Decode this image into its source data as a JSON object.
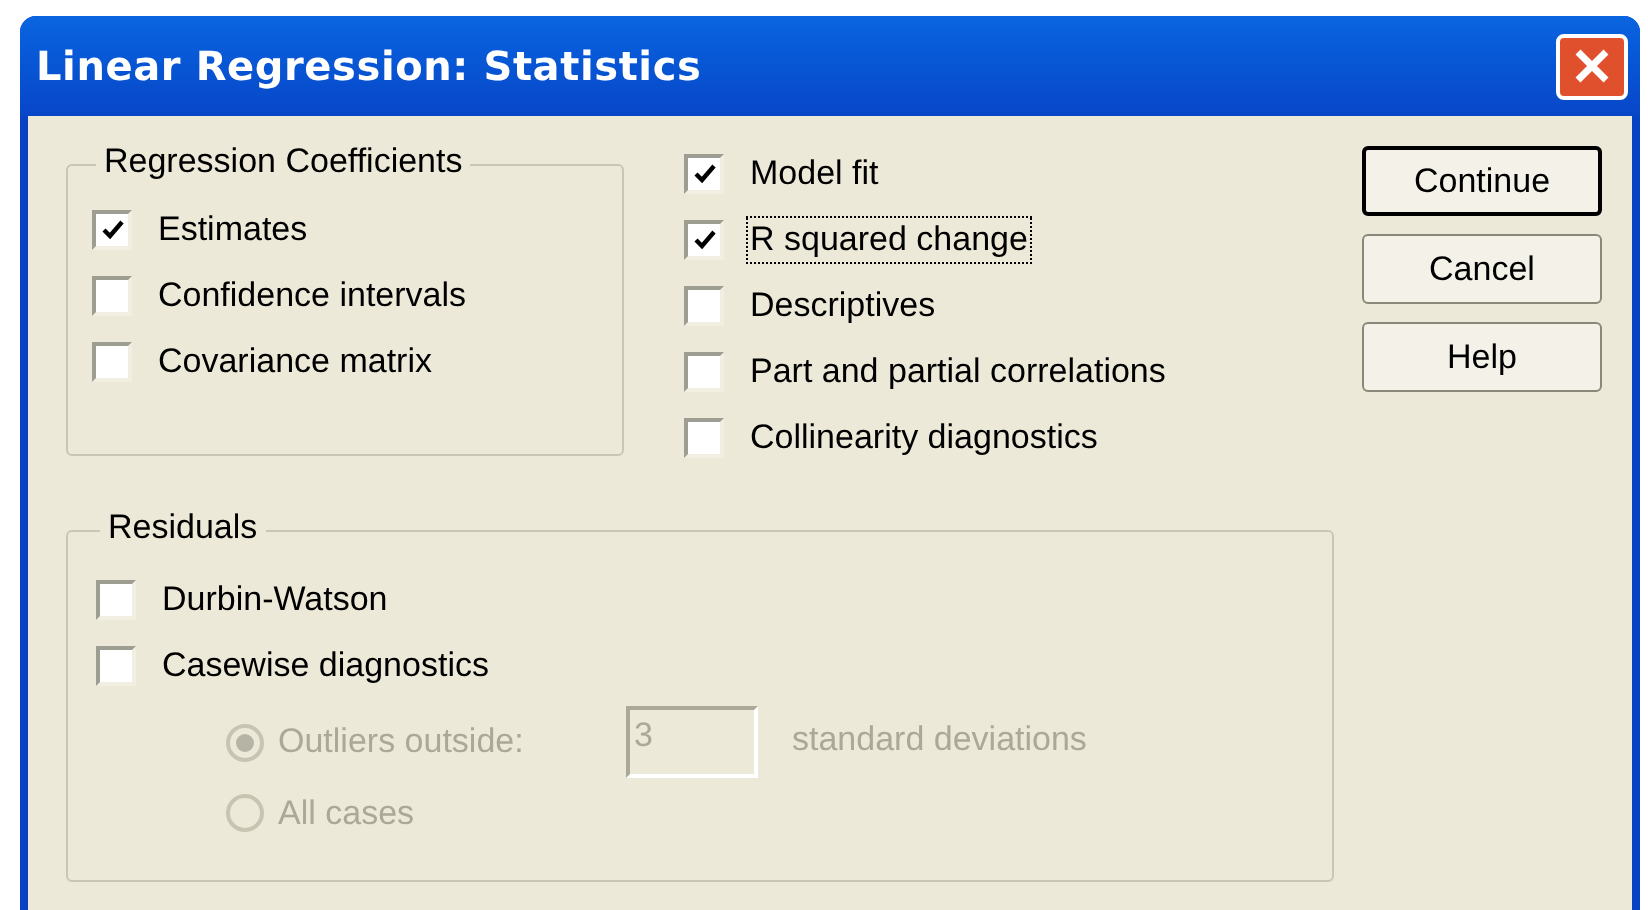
{
  "window": {
    "title": "Linear Regression: Statistics"
  },
  "regression_coefficients": {
    "title": "Regression Coefficients",
    "items": [
      {
        "label": "Estimates",
        "checked": true
      },
      {
        "label": "Confidence intervals",
        "checked": false
      },
      {
        "label": "Covariance matrix",
        "checked": false
      }
    ]
  },
  "options": [
    {
      "label": "Model fit",
      "checked": true,
      "focused": false
    },
    {
      "label": "R squared change",
      "checked": true,
      "focused": true
    },
    {
      "label": "Descriptives",
      "checked": false,
      "focused": false
    },
    {
      "label": "Part and partial correlations",
      "checked": false,
      "focused": false
    },
    {
      "label": "Collinearity diagnostics",
      "checked": false,
      "focused": false
    }
  ],
  "buttons": [
    {
      "label": "Continue",
      "default": true
    },
    {
      "label": "Cancel",
      "default": false
    },
    {
      "label": "Help",
      "default": false
    }
  ],
  "residuals": {
    "title": "Residuals",
    "items": [
      {
        "label": "Durbin-Watson",
        "checked": false
      },
      {
        "label": "Casewise diagnostics",
        "checked": false
      }
    ],
    "casewise": {
      "disabled": true,
      "outliers": {
        "label": "Outliers outside:",
        "selected": true
      },
      "value": "3",
      "unit": "standard deviations",
      "all_cases": {
        "label": "All cases",
        "selected": false
      }
    }
  }
}
